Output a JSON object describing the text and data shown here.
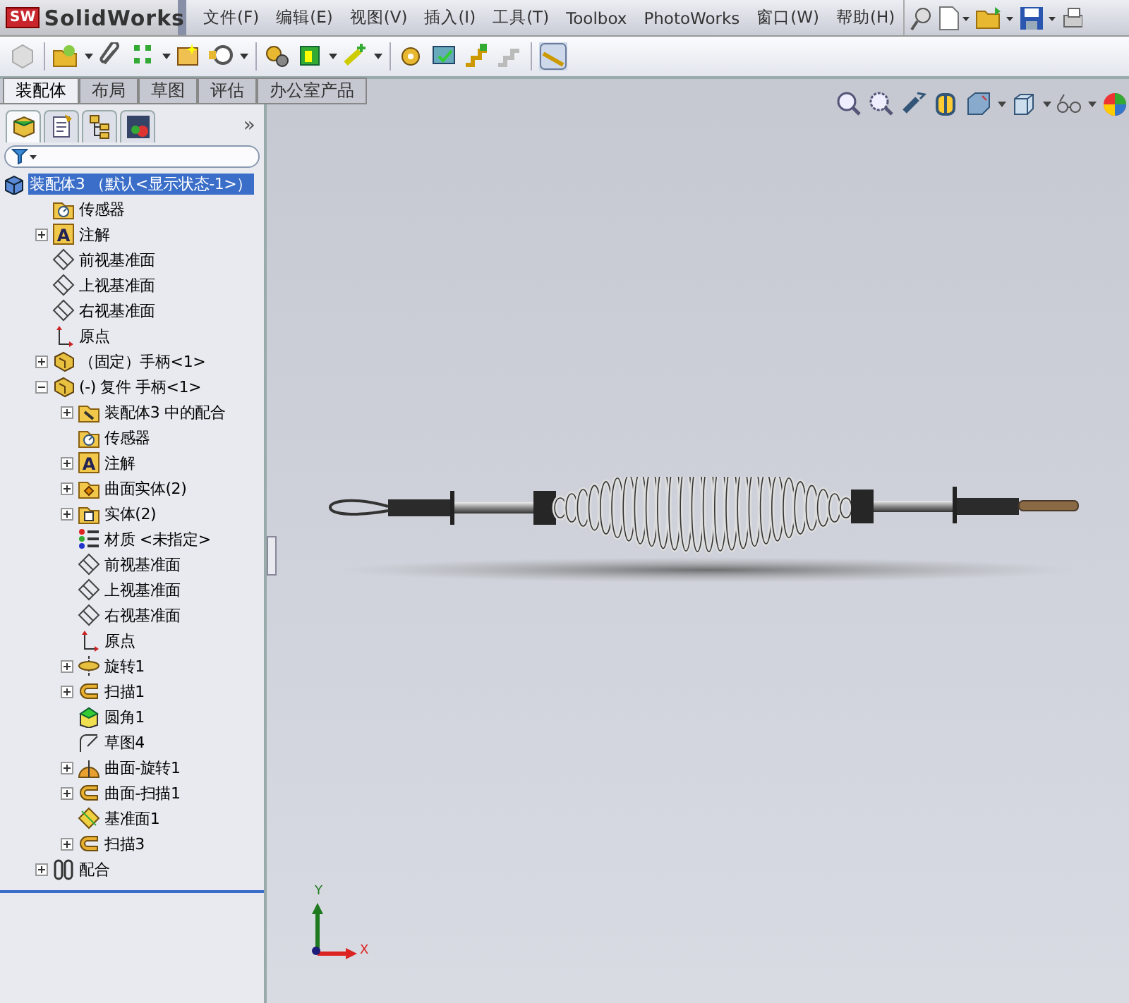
{
  "app": {
    "logo_badge": "SW",
    "logo_text": "SolidWorks"
  },
  "menu": [
    "文件(F)",
    "编辑(E)",
    "视图(V)",
    "插入(I)",
    "工具(T)",
    "Toolbox",
    "PhotoWorks",
    "窗口(W)",
    "帮助(H)"
  ],
  "command_tabs": [
    {
      "label": "装配体",
      "selected": true
    },
    {
      "label": "布局",
      "selected": false
    },
    {
      "label": "草图",
      "selected": false
    },
    {
      "label": "评估",
      "selected": false
    },
    {
      "label": "办公室产品",
      "selected": false
    }
  ],
  "panel_tabs": [
    {
      "kind": "feature",
      "selected": true
    },
    {
      "kind": "property",
      "selected": false
    },
    {
      "kind": "configuration",
      "selected": false
    },
    {
      "kind": "display",
      "selected": false
    }
  ],
  "panel_more": "»",
  "tree": [
    {
      "label": "装配体3 （默认<显示状态-1>）",
      "kind": "assembly",
      "selected": true,
      "children": [
        {
          "label": "传感器",
          "kind": "sensor",
          "selected": false
        },
        {
          "label": "注解",
          "kind": "annotation",
          "icon_glyph": "A",
          "selected": false,
          "expanded": false
        },
        {
          "label": "前视基准面",
          "kind": "plane",
          "selected": false
        },
        {
          "label": "上视基准面",
          "kind": "plane",
          "selected": false
        },
        {
          "label": "右视基准面",
          "kind": "plane",
          "selected": false
        },
        {
          "label": "原点",
          "kind": "origin",
          "selected": false
        },
        {
          "label": "（固定）手柄<1>",
          "kind": "part",
          "selected": false,
          "expanded": false
        },
        {
          "label": "(-) 复件 手柄<1>",
          "kind": "part",
          "selected": false,
          "expanded": true,
          "children": [
            {
              "label": "装配体3 中的配合",
              "kind": "mates-folder",
              "selected": false,
              "expanded": false
            },
            {
              "label": "传感器",
              "kind": "sensor",
              "selected": false
            },
            {
              "label": "注解",
              "kind": "annotation",
              "icon_glyph": "A",
              "selected": false,
              "expanded": false
            },
            {
              "label": "曲面实体(2)",
              "kind": "surface-bodies",
              "selected": false,
              "expanded": false
            },
            {
              "label": "实体(2)",
              "kind": "solid-bodies",
              "selected": false,
              "expanded": false
            },
            {
              "label": "材质 <未指定>",
              "kind": "material",
              "selected": false
            },
            {
              "label": "前视基准面",
              "kind": "plane",
              "selected": false
            },
            {
              "label": "上视基准面",
              "kind": "plane",
              "selected": false
            },
            {
              "label": "右视基准面",
              "kind": "plane",
              "selected": false
            },
            {
              "label": "原点",
              "kind": "origin",
              "selected": false
            },
            {
              "label": "旋转1",
              "kind": "revolve",
              "selected": false,
              "expanded": false
            },
            {
              "label": "扫描1",
              "kind": "sweep",
              "selected": false,
              "expanded": false
            },
            {
              "label": "圆角1",
              "kind": "fillet",
              "selected": false
            },
            {
              "label": "草图4",
              "kind": "sketch",
              "selected": false
            },
            {
              "label": "曲面-旋转1",
              "kind": "surface-revolve",
              "selected": false,
              "expanded": false
            },
            {
              "label": "曲面-扫描1",
              "kind": "sweep",
              "selected": false,
              "expanded": false
            },
            {
              "label": "基准面1",
              "kind": "ref-plane",
              "selected": false
            },
            {
              "label": "扫描3",
              "kind": "sweep",
              "selected": false,
              "expanded": false
            }
          ]
        },
        {
          "label": "配合",
          "kind": "mates",
          "selected": false,
          "expanded": false
        }
      ]
    }
  ],
  "triad": {
    "y_label": "Y",
    "x_label": "X"
  }
}
